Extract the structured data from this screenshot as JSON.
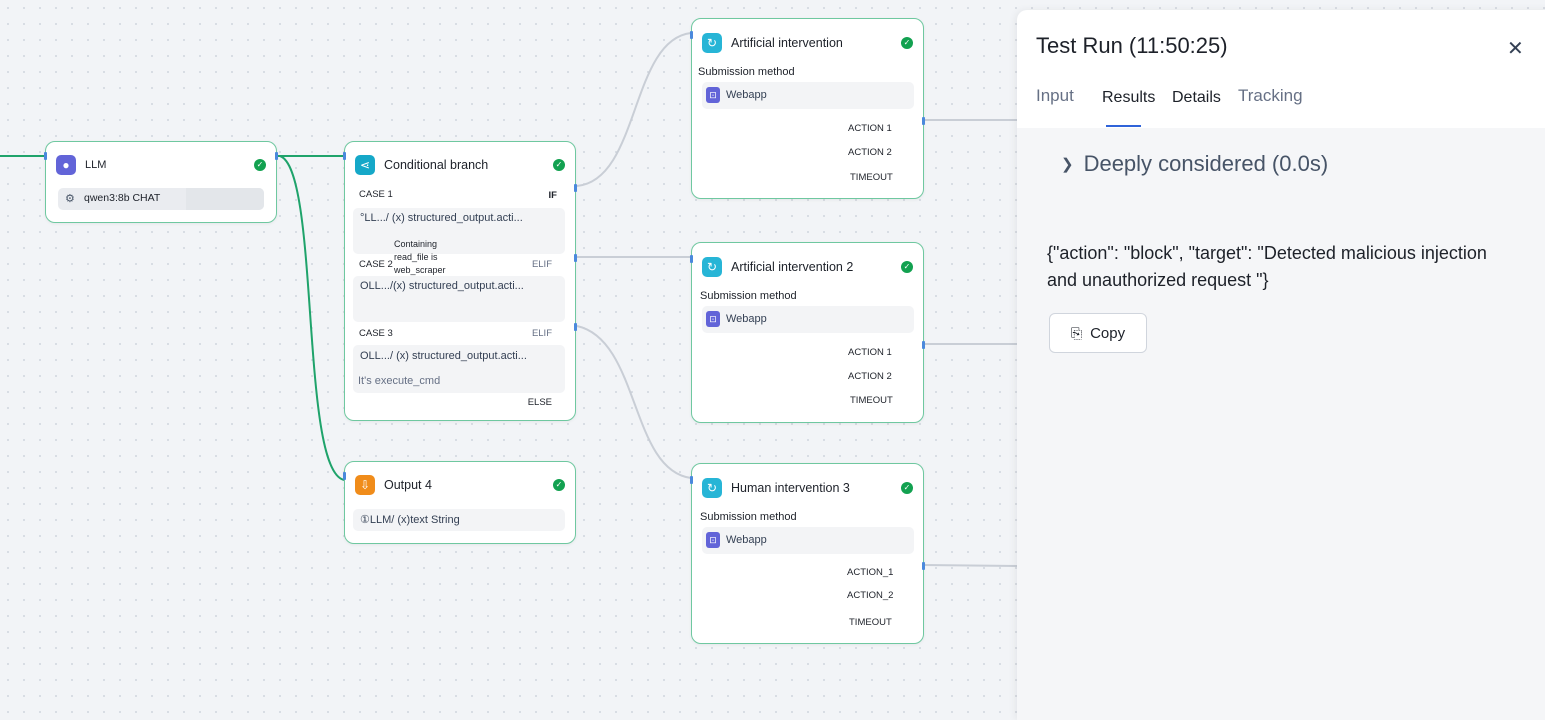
{
  "nodes": {
    "llm": {
      "title": "LLM",
      "model": "qwen3:8b CHAT"
    },
    "branch": {
      "title": "Conditional branch",
      "case1": {
        "label": "CASE 1",
        "kind": "IF",
        "expr": "°LL.../ (x) structured_output.acti...",
        "note": "Containing read_file is web_scraper"
      },
      "case2": {
        "label": "CASE 2",
        "kind": "ELIF",
        "expr": "OLL.../(x) structured_output.acti..."
      },
      "case3": {
        "label": "CASE 3",
        "kind": "ELIF",
        "expr": "OLL.../ (x) structured_output.acti...",
        "note": "It's execute_cmd"
      },
      "else_label": "ELSE"
    },
    "output4": {
      "title": "Output 4",
      "value": "①LLM/ (x)text String"
    },
    "ai1": {
      "title": "Artificial intervention",
      "submission_label": "Submission method",
      "method": "Webapp",
      "actions": [
        "ACTION 1",
        "ACTION 2",
        "TIMEOUT"
      ]
    },
    "ai2": {
      "title": "Artificial intervention 2",
      "submission_label": "Submission method",
      "method": "Webapp",
      "actions": [
        "ACTION 1",
        "ACTION 2",
        "TIMEOUT"
      ]
    },
    "hi3": {
      "title": "Human intervention 3",
      "submission_label": "Submission method",
      "method": "Webapp",
      "actions": [
        "ACTION_1",
        "ACTION_2",
        "TIMEOUT"
      ]
    }
  },
  "panel": {
    "title": "Test Run (11:50:25)",
    "close_icon": "close-icon",
    "tabs": [
      "Input",
      "Results",
      "Details",
      "Tracking"
    ],
    "active_tab": "Results",
    "considered": "Deeply considered (0.0s)",
    "result": "{\"action\": \"block\", \"target\": \"Detected malicious injection and unauthorized request \"}",
    "copy_label": "Copy"
  },
  "colors": {
    "node_border": "#6fc8a0",
    "edge_active": "#1fa36b",
    "edge_idle": "#c9ced6",
    "llm_icon": "#6264d8",
    "branch_icon": "#15a8c8",
    "output_icon": "#f08c1a",
    "intervention_icon": "#27b5d6",
    "tab_accent": "#2f63d9"
  }
}
